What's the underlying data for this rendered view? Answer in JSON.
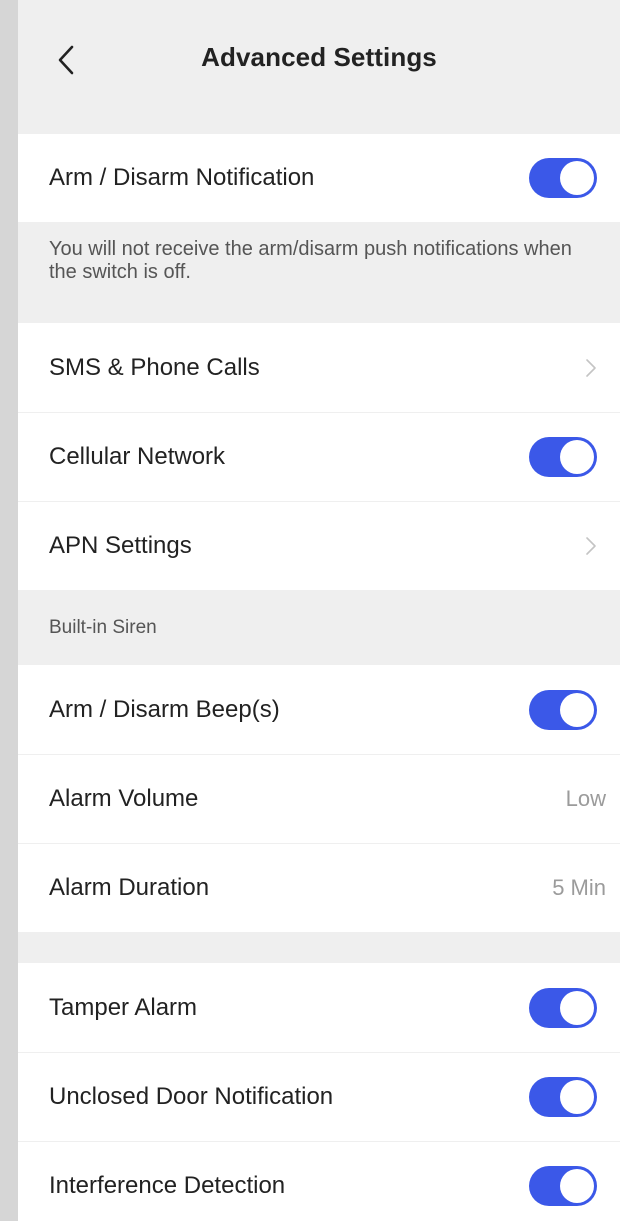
{
  "header": {
    "title": "Advanced Settings"
  },
  "notification": {
    "label": "Arm / Disarm Notification",
    "enabled": true,
    "note": "You will not receive the arm/disarm push notifications when the switch is off."
  },
  "network": {
    "sms_label": "SMS & Phone Calls",
    "cellular_label": "Cellular Network",
    "cellular_enabled": true,
    "apn_label": "APN Settings"
  },
  "siren": {
    "section_title": "Built-in Siren",
    "beep_label": "Arm / Disarm Beep(s)",
    "beep_enabled": true,
    "volume_label": "Alarm Volume",
    "volume_value": "Low",
    "duration_label": "Alarm Duration",
    "duration_value": "5 Min"
  },
  "alarms": {
    "tamper_label": "Tamper Alarm",
    "tamper_enabled": true,
    "unclosed_label": "Unclosed Door Notification",
    "unclosed_enabled": true,
    "interference_label": "Interference Detection",
    "interference_enabled": true
  },
  "colors": {
    "accent": "#3b58e8",
    "background": "#efefef",
    "row": "#ffffff"
  }
}
